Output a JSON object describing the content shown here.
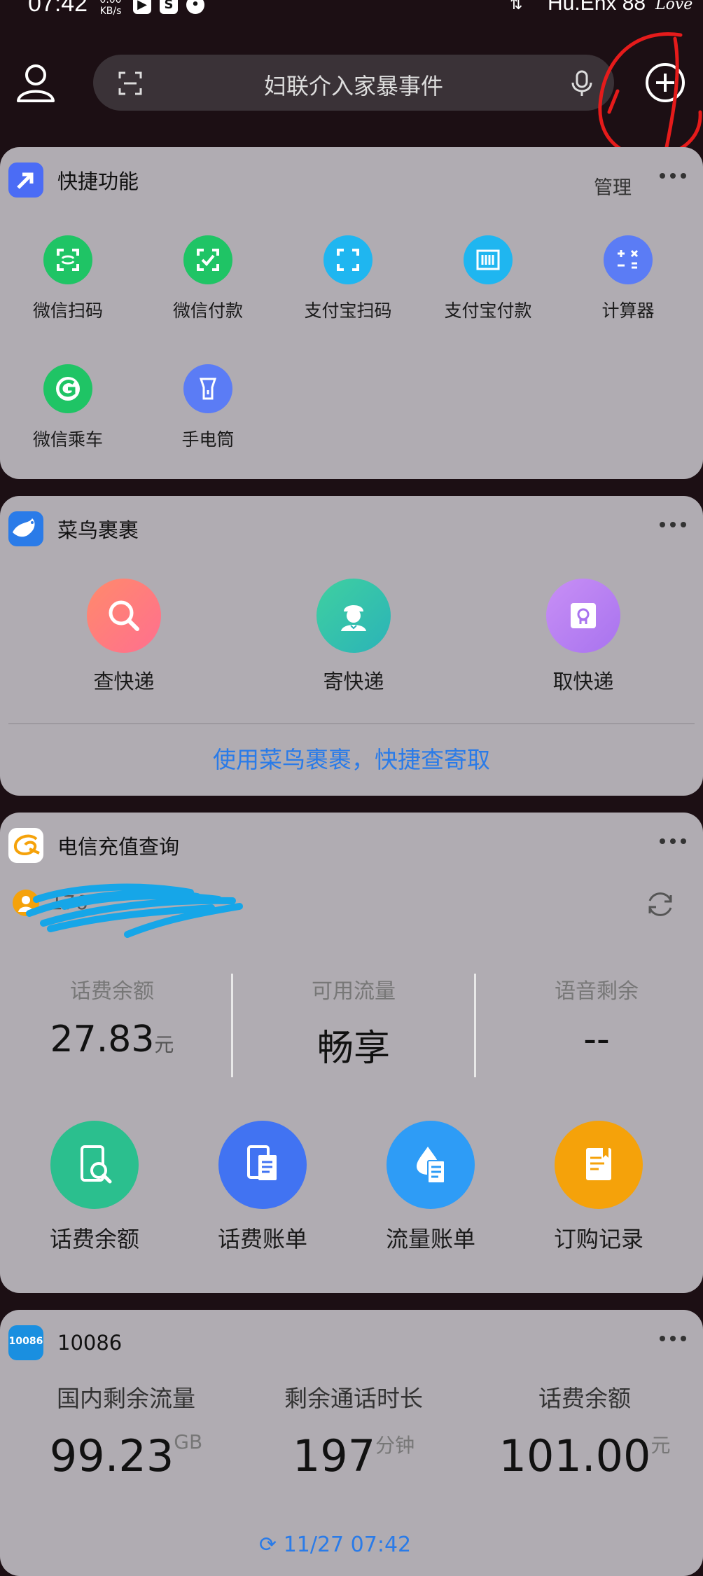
{
  "status_bar": {
    "time": "07:42",
    "net_speed": "0.00",
    "net_unit": "KB/s",
    "carrier": "Hu.Enx 88",
    "love": "Love"
  },
  "search": {
    "placeholder": "妇联介入家暴事件"
  },
  "quick_functions": {
    "title": "快捷功能",
    "manage_label": "管理",
    "items": [
      {
        "label": "微信扫码",
        "icon": "wechat-scan-icon",
        "color": "#1fc465"
      },
      {
        "label": "微信付款",
        "icon": "wechat-pay-icon",
        "color": "#1fc465"
      },
      {
        "label": "支付宝扫码",
        "icon": "alipay-scan-icon",
        "color": "#1fb6f0"
      },
      {
        "label": "支付宝付款",
        "icon": "alipay-pay-icon",
        "color": "#1fb6f0"
      },
      {
        "label": "计算器",
        "icon": "calculator-icon",
        "color": "#5b7cf5"
      },
      {
        "label": "微信乘车",
        "icon": "wechat-ride-icon",
        "color": "#1fc465"
      },
      {
        "label": "手电筒",
        "icon": "flashlight-icon",
        "color": "#5b7cf5"
      }
    ]
  },
  "cainiao": {
    "title": "菜鸟裹裹",
    "actions": [
      {
        "label": "查快递",
        "icon": "search-package-icon"
      },
      {
        "label": "寄快递",
        "icon": "courier-icon"
      },
      {
        "label": "取快递",
        "icon": "pickup-locker-icon"
      }
    ],
    "link_text": "使用菜鸟裹裹，快捷查寄取"
  },
  "telecom": {
    "title": "电信充值查询",
    "phone": "176",
    "stats": [
      {
        "label": "话费余额",
        "value": "27.83",
        "unit": "元"
      },
      {
        "label": "可用流量",
        "value": "畅享",
        "unit": ""
      },
      {
        "label": "语音剩余",
        "value": "--",
        "unit": ""
      }
    ],
    "actions": [
      {
        "label": "话费余额",
        "icon": "balance-query-icon",
        "color": "#2bbf8e"
      },
      {
        "label": "话费账单",
        "icon": "bill-icon",
        "color": "#4173f2"
      },
      {
        "label": "流量账单",
        "icon": "data-bill-icon",
        "color": "#2e9cf6"
      },
      {
        "label": "订购记录",
        "icon": "order-record-icon",
        "color": "#f5a20a"
      }
    ]
  },
  "cmcc": {
    "title": "10086",
    "logo_text": "10086",
    "stats": [
      {
        "label": "国内剩余流量",
        "value": "99.23",
        "unit": "GB"
      },
      {
        "label": "剩余通话时长",
        "value": "197",
        "unit": "分钟"
      },
      {
        "label": "话费余额",
        "value": "101.00",
        "unit": "元"
      }
    ],
    "updated": "11/27 07:42"
  }
}
